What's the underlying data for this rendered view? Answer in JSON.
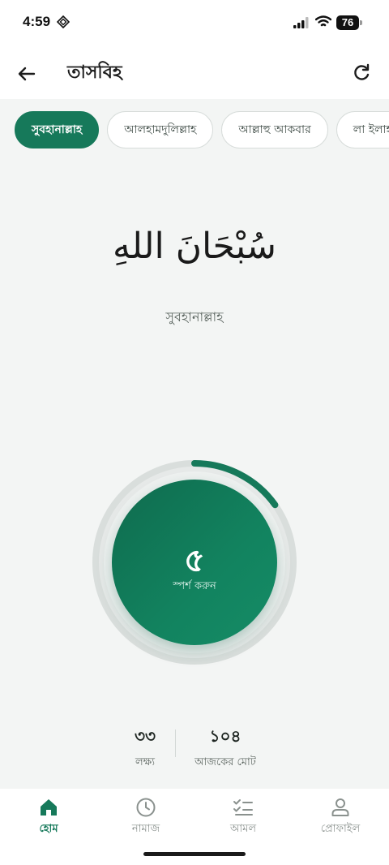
{
  "status_bar": {
    "time": "4:59",
    "battery": "76"
  },
  "header": {
    "title": "তাসবিহ",
    "back_icon": "arrow-left-icon",
    "refresh_icon": "refresh-icon"
  },
  "chips": [
    {
      "label": "সুবহানাল্লাহ",
      "active": true
    },
    {
      "label": "আলহামদুলিল্লাহ",
      "active": false
    },
    {
      "label": "আল্লাহু আকবার",
      "active": false
    },
    {
      "label": "লা ইলাহা ইল্লাল্লাহ",
      "active": false
    }
  ],
  "dhikr": {
    "arabic": "سُبْحَانَ اللهِ",
    "name": "সুবহানাল্লাহ"
  },
  "counter": {
    "value": "৫",
    "hint": "স্পর্শ করুন",
    "progress": 0.1515,
    "accent": "#16795a"
  },
  "stats": {
    "target_value": "৩৩",
    "target_label": "লক্ষ্য",
    "today_value": "১০৪",
    "today_label": "আজকের মোট"
  },
  "nav": [
    {
      "label": "হোম",
      "icon": "home-icon",
      "active": true
    },
    {
      "label": "নামাজ",
      "icon": "clock-icon",
      "active": false
    },
    {
      "label": "আমল",
      "icon": "checklist-icon",
      "active": false
    },
    {
      "label": "প্রোফাইল",
      "icon": "user-icon",
      "active": false
    }
  ]
}
